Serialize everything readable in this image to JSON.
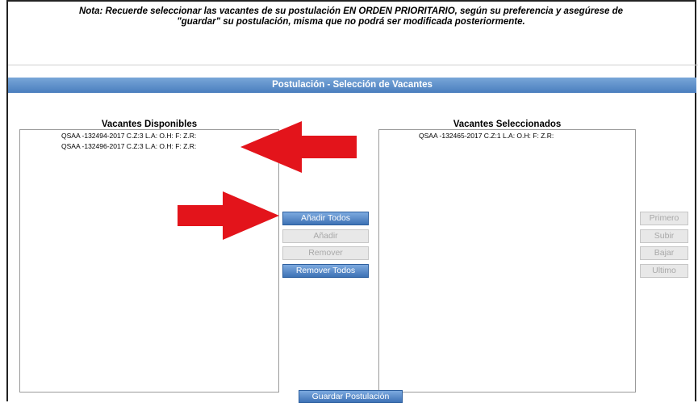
{
  "note": {
    "line1": "Nota: Recuerde seleccionar las vacantes de su postulación EN ORDEN PRIORITARIO, según su preferencia y asegúrese de",
    "line2": "\"guardar\" su postulación, misma que no podrá ser modificada posteriormente."
  },
  "section_title": "Postulación - Selección de Vacantes",
  "available": {
    "title": "Vacantes Disponibles",
    "items": [
      "QSAA -132494-2017 C.Z:3 L.A: O.H: F: Z.R:",
      "QSAA -132496-2017 C.Z:3 L.A: O.H: F: Z.R:"
    ]
  },
  "selected": {
    "title": "Vacantes Seleccionados",
    "items": [
      "QSAA -132465-2017 C.Z:1 L.A: O.H: F: Z.R:"
    ]
  },
  "transfer_buttons": {
    "add_all": "Añadir Todos",
    "add": "Añadir",
    "remove": "Remover",
    "remove_all": "Remover Todos"
  },
  "order_buttons": {
    "first": "Primero",
    "up": "Subir",
    "down": "Bajar",
    "last": "Ultimo"
  },
  "save_button": "Guardar Postulación",
  "colors": {
    "title_bar": "#4a7ebe",
    "button_active": "#3e72b5",
    "arrow": "#e3141b"
  }
}
